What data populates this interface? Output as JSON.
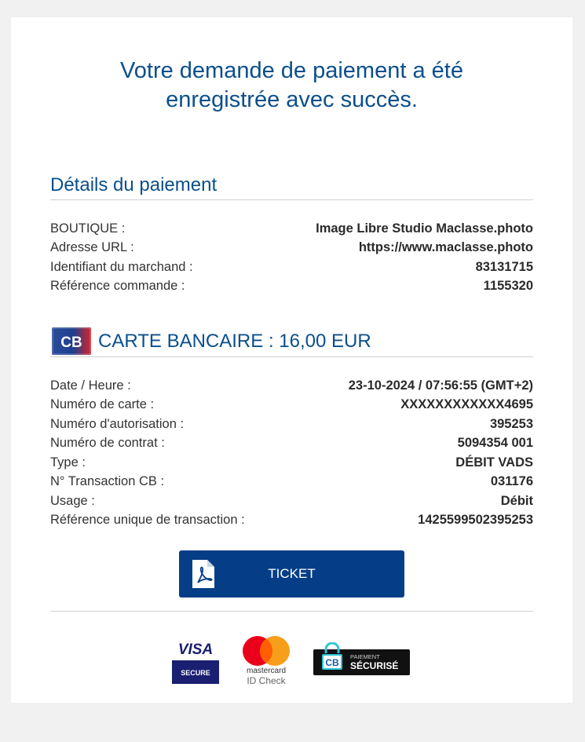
{
  "headline": {
    "line1": "Votre demande de paiement a été",
    "line2": "enregistrée avec succès."
  },
  "payment_details": {
    "title": "Détails du paiement",
    "rows": [
      {
        "label": "BOUTIQUE :",
        "value": "Image Libre Studio Maclasse.photo"
      },
      {
        "label": "Adresse URL :",
        "value": "https://www.maclasse.photo"
      },
      {
        "label": "Identifiant du marchand :",
        "value": "83131715"
      },
      {
        "label": "Référence commande :",
        "value": "1155320"
      }
    ]
  },
  "card_section": {
    "logo_text": "CB",
    "title": "CARTE BANCAIRE : 16,00 EUR",
    "rows": [
      {
        "label": "Date / Heure :",
        "value": "23-10-2024 / 07:56:55 (GMT+2)"
      },
      {
        "label": "Numéro de carte :",
        "value": "XXXXXXXXXXXX4695"
      },
      {
        "label": "Numéro d'autorisation :",
        "value": "395253"
      },
      {
        "label": "Numéro de contrat :",
        "value": "5094354 001"
      },
      {
        "label": "Type :",
        "value": "DÉBIT VADS"
      },
      {
        "label": "N° Transaction CB :",
        "value": "031176"
      },
      {
        "label": "Usage :",
        "value": "Débit"
      },
      {
        "label": "Référence unique de transaction :",
        "value": "1425599502395253"
      }
    ]
  },
  "ticket_button": {
    "label": "TICKET",
    "icon": "pdf-icon"
  },
  "security_logos": {
    "visa": {
      "brand": "VISA",
      "caption": "SECURE"
    },
    "mastercard": {
      "brand": "mastercard",
      "caption": "ID Check"
    },
    "cb": {
      "small": "PAIEMENT",
      "big": "SÉCURISÉ",
      "logo_text": "CB"
    }
  },
  "colors": {
    "title_blue": "#0b4f8c",
    "button_blue": "#053e87",
    "visa_navy": "#1a1f71",
    "mc_red": "#eb001b",
    "mc_orange": "#f79e1b"
  }
}
